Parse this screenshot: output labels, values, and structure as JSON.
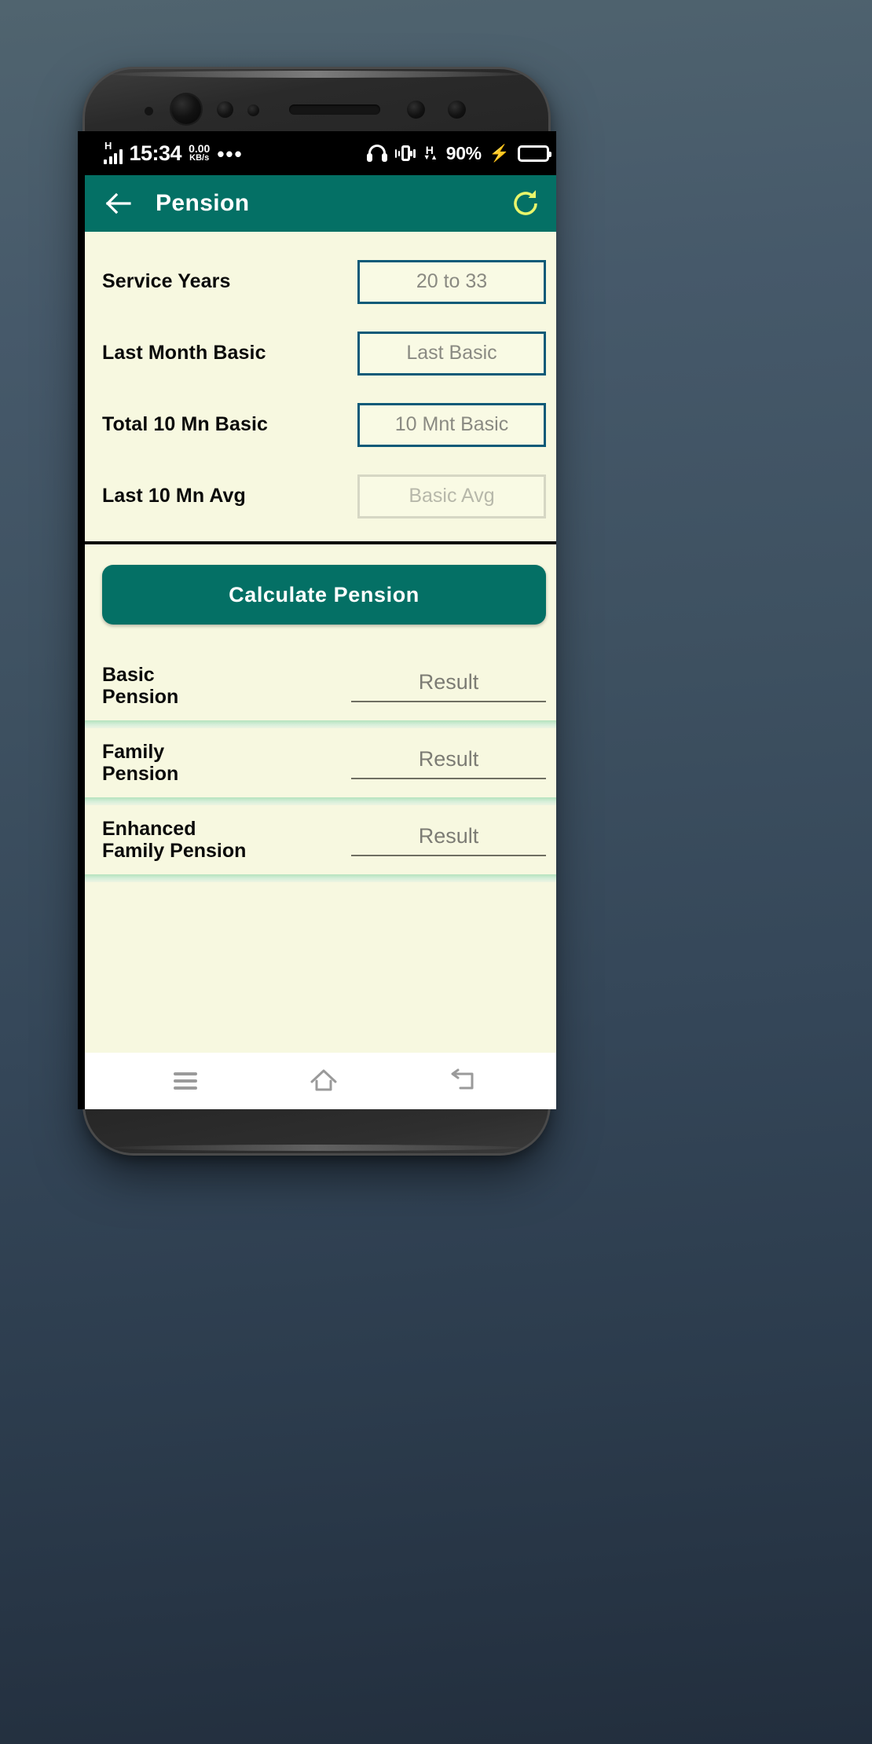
{
  "device": {
    "sensors": [
      "proximity-sensor",
      "front-camera",
      "ir-sensor",
      "light-sensor",
      "earpiece-speaker",
      "sensor-dot-4",
      "sensor-dot-5"
    ]
  },
  "statusbar": {
    "network_type": "H",
    "signal_bars": 4,
    "time": "15:34",
    "data_speed_value": "0.00",
    "data_speed_unit": "KB/s",
    "overflow": "•••",
    "headphone_icon": "headphone-icon",
    "vibrate_icon": "vibrate-icon",
    "data_icon_label": "H",
    "data_icon_arrows": "▼▲",
    "battery_percent": "90%",
    "charging_icon": "⚡",
    "battery_icon": "battery-full-icon"
  },
  "appbar": {
    "back_icon": "back-arrow-icon",
    "title": "Pension",
    "refresh_icon": "refresh-icon",
    "bg_color": "#047065",
    "title_color": "#ffffff",
    "refresh_color": "#E8F56B"
  },
  "form": {
    "rows": [
      {
        "label": "Service Years",
        "placeholder": "20 to 33",
        "value": "",
        "disabled": false
      },
      {
        "label": "Last Month Basic",
        "placeholder": "Last Basic",
        "value": "",
        "disabled": false
      },
      {
        "label": "Total 10 Mn Basic",
        "placeholder": "10 Mnt Basic",
        "value": "",
        "disabled": false
      },
      {
        "label": "Last 10 Mn Avg",
        "placeholder": "Basic Avg",
        "value": "",
        "disabled": true
      }
    ]
  },
  "action": {
    "calculate_label": "Calculate Pension"
  },
  "results": {
    "rows": [
      {
        "label": "Basic\nPension",
        "value": "Result"
      },
      {
        "label": "Family\nPension",
        "value": "Result"
      },
      {
        "label": "Enhanced\nFamily Pension",
        "value": "Result"
      }
    ]
  },
  "navbar": {
    "recent_icon": "recent-apps-icon",
    "home_icon": "home-icon",
    "back_icon": "back-nav-icon"
  },
  "colors": {
    "accent_teal": "#047065",
    "screen_bg": "#F7F8E0",
    "input_border": "#0c5a78",
    "input_border_disabled": "#d6d7c4",
    "divider_green": "#b5e3bd",
    "refresh_yellow": "#E8F56B",
    "wallpaper_top": "#50646f",
    "wallpaper_bottom": "#222e3d"
  }
}
